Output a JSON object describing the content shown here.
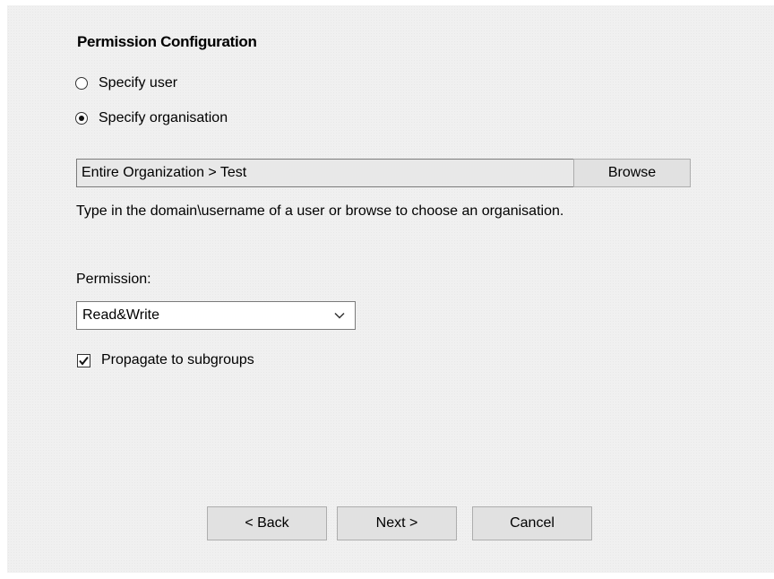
{
  "title": "Permission Configuration",
  "options": [
    {
      "label": "Specify user",
      "selected": false
    },
    {
      "label": "Specify organisation",
      "selected": true
    }
  ],
  "organisation": {
    "value": "Entire Organization > Test",
    "browse_label": "Browse"
  },
  "help_text": "Type in the domain\\username of a user or browse to choose an organisation.",
  "permission": {
    "label": "Permission:",
    "selected": "Read&Write",
    "dropdown_icon": "chevron-down-icon"
  },
  "propagate": {
    "label": "Propagate to subgroups",
    "checked": true,
    "icon": "checkmark-icon"
  },
  "buttons": {
    "back": "< Back",
    "next": "Next >",
    "cancel": "Cancel"
  }
}
